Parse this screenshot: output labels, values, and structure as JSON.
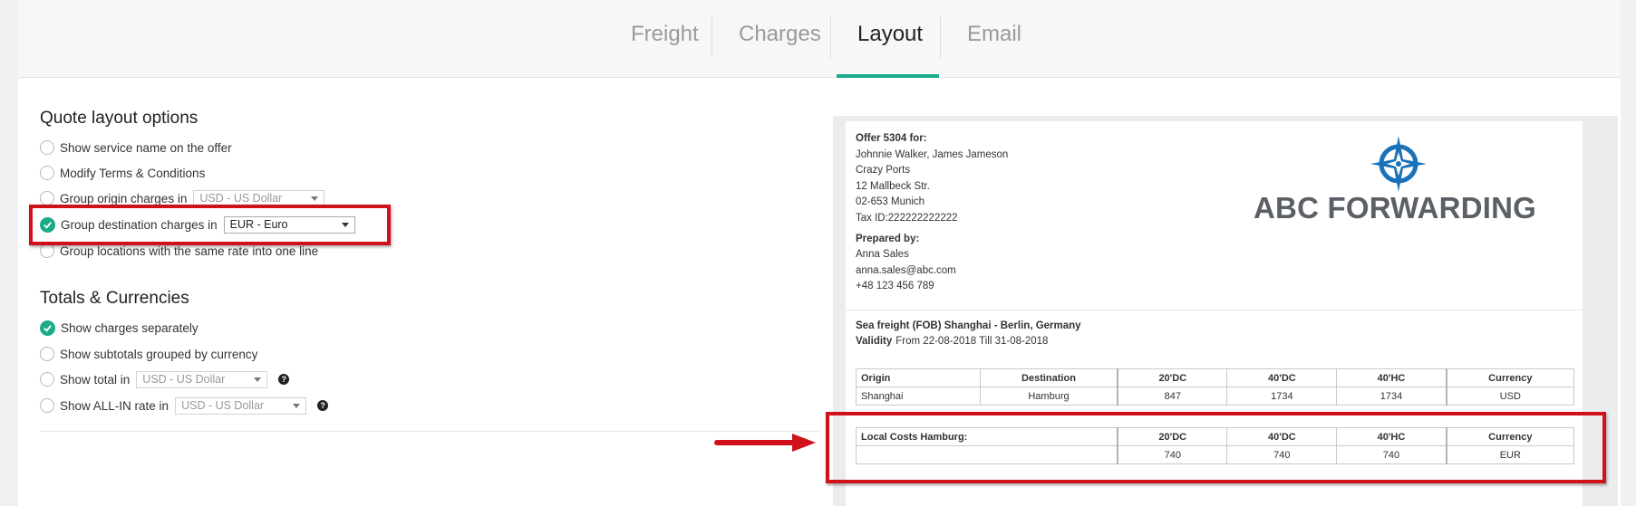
{
  "tabs": [
    {
      "label": "Freight",
      "active": false
    },
    {
      "label": "Charges",
      "active": false
    },
    {
      "label": "Layout",
      "active": true
    },
    {
      "label": "Email",
      "active": false
    }
  ],
  "accent_color": "#1aab8a",
  "highlight_color": "#d0101a",
  "quote_layout": {
    "title": "Quote layout options",
    "show_service_name": "Show service name on the offer",
    "modify_terms": "Modify Terms & Conditions",
    "group_origin": "Group origin charges in",
    "group_origin_currency": "USD - US Dollar",
    "group_destination": "Group destination charges in",
    "group_destination_currency": "EUR - Euro",
    "group_locations": "Group locations with the same rate into one line"
  },
  "totals": {
    "title": "Totals & Currencies",
    "show_separately": "Show charges separately",
    "show_subtotals": "Show subtotals grouped by currency",
    "show_total": "Show total in",
    "show_total_currency": "USD - US Dollar",
    "show_allin": "Show ALL-IN rate in",
    "show_allin_currency": "USD - US Dollar"
  },
  "preview": {
    "offer_title": "Offer 5304 for:",
    "client_lines": [
      "Johnnie Walker, James Jameson",
      "Crazy Ports",
      "12 Mallbeck Str.",
      "02-653 Munich",
      "Tax ID:222222222222"
    ],
    "prepared_title": "Prepared by:",
    "prepared_lines": [
      "Anna Sales",
      "anna.sales@abc.com",
      "+48 123 456 789"
    ],
    "logo_text": "ABC FORWARDING",
    "freight_title": "Sea freight (FOB) Shanghai - Berlin, Germany",
    "validity_label": "Validity",
    "validity_value": "From 22-08-2018 Till 31-08-2018",
    "freight_table": {
      "headers": [
        "Origin",
        "Destination",
        "20'DC",
        "40'DC",
        "40'HC",
        "Currency"
      ],
      "row": [
        "Shanghai",
        "Hamburg",
        "847",
        "1734",
        "1734",
        "USD"
      ]
    },
    "local_table": {
      "headers": [
        "Local Costs Hamburg:",
        "20'DC",
        "40'DC",
        "40'HC",
        "Currency"
      ],
      "row": [
        "",
        "740",
        "740",
        "740",
        "EUR"
      ]
    }
  }
}
